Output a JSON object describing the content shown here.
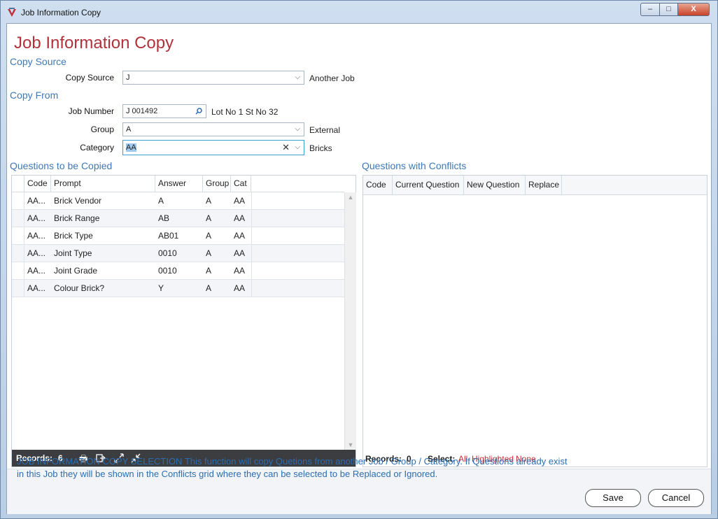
{
  "window": {
    "title": "Job Information Copy",
    "minimize_glyph": "–",
    "maximize_glyph": "□",
    "close_glyph": "X"
  },
  "page": {
    "title": "Job Information Copy"
  },
  "copy_source_section": {
    "heading": "Copy Source",
    "copy_source": {
      "label": "Copy Source",
      "value": "J",
      "description": "Another Job"
    }
  },
  "copy_from_section": {
    "heading": "Copy From",
    "job_number": {
      "label": "Job Number",
      "value": "J 001492",
      "description": "Lot No 1 St No 32"
    },
    "group": {
      "label": "Group",
      "value": "A",
      "description": "External"
    },
    "category": {
      "label": "Category",
      "value": "AA",
      "description": "Bricks"
    }
  },
  "questions_grid": {
    "heading": "Questions to be Copied",
    "columns": [
      "Code",
      "Prompt",
      "Answer",
      "Group",
      "Cat"
    ],
    "rows": [
      {
        "code": "AA...",
        "prompt": "Brick Vendor",
        "answer": "A",
        "group": "A",
        "cat": "AA"
      },
      {
        "code": "AA...",
        "prompt": "Brick Range",
        "answer": "AB",
        "group": "A",
        "cat": "AA"
      },
      {
        "code": "AA...",
        "prompt": "Brick Type",
        "answer": "AB01",
        "group": "A",
        "cat": "AA"
      },
      {
        "code": "AA...",
        "prompt": "Joint Type",
        "answer": "0010",
        "group": "A",
        "cat": "AA"
      },
      {
        "code": "AA...",
        "prompt": "Joint Grade",
        "answer": "0010",
        "group": "A",
        "cat": "AA"
      },
      {
        "code": "AA...",
        "prompt": "Colour Brick?",
        "answer": "Y",
        "group": "A",
        "cat": "AA"
      }
    ],
    "footer": {
      "records_label": "Records:",
      "records_count": "6"
    }
  },
  "conflicts_grid": {
    "heading": "Questions with Conflicts",
    "columns": [
      "Code",
      "Current Question",
      "New Question",
      "Replace"
    ],
    "footer": {
      "records_label": "Records:",
      "records_count": "0",
      "select_label": "Select:",
      "select_all": "All",
      "select_highlighted": "Highlighted",
      "select_none": "None"
    }
  },
  "help_text": "JOB INFORMATION COPY SELECTION This function will copy Quetions from another Job / Group / Category. If Questions already exist in this Job they will be shown in the Conflicts grid where they can be selected to be Replaced or Ignored.",
  "buttons": {
    "save": "Save",
    "cancel": "Cancel"
  },
  "colors": {
    "title_red": "#b0333b",
    "section_blue": "#3f78b6",
    "link_red": "#c0303a"
  }
}
